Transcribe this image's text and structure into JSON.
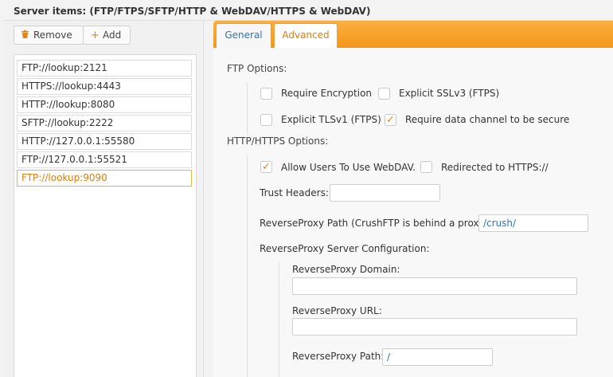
{
  "header": {
    "title": "Server items: (FTP/FTPS/SFTP/HTTP & WebDAV/HTTPS & WebDAV)"
  },
  "toolbar": {
    "remove_label": "Remove",
    "add_label": "Add",
    "remove_icon": "trash-icon",
    "add_icon": "plus-icon"
  },
  "servers": [
    "FTP://lookup:2121",
    "HTTPS://lookup:4443",
    "HTTP://lookup:8080",
    "SFTP://lookup:2222",
    "HTTP://127.0.0.1:55580",
    "FTP://127.0.0.1:55521",
    "FTP://lookup:9090"
  ],
  "selected_server": "FTP://lookup:9090",
  "tabs": {
    "general": "General",
    "advanced": "Advanced",
    "active": "Advanced"
  },
  "ftp": {
    "section": "FTP Options:",
    "require_encryption": {
      "label": "Require Encryption",
      "checked": false
    },
    "explicit_sslv3": {
      "label": "Explicit SSLv3 (FTPS)",
      "checked": false
    },
    "explicit_tlsv1": {
      "label": "Explicit TLSv1 (FTPS)",
      "checked": false
    },
    "require_secure_data": {
      "label": "Require data channel to be secure",
      "checked": true
    }
  },
  "http": {
    "section": "HTTP/HTTPS Options:",
    "allow_webdav": {
      "label": "Allow Users To Use WebDAV.",
      "checked": true
    },
    "redirect_https": {
      "label": "Redirected to HTTPS://",
      "checked": false
    },
    "trust_headers": {
      "label": "Trust Headers:",
      "value": ""
    },
    "reverse_proxy_path": {
      "label": "ReverseProxy Path (CrushFTP is behind a proxy):",
      "value": "/crush/"
    },
    "rp_config_label": "ReverseProxy Server Configuration:",
    "rp_domain": {
      "label": "ReverseProxy Domain:",
      "value": ""
    },
    "rp_url": {
      "label": "ReverseProxy URL:",
      "value": ""
    },
    "rp_path": {
      "label": "ReverseProxy Path:",
      "value": "/"
    }
  },
  "colors": {
    "accent": "#f4961a",
    "link": "#2e73b8",
    "selected": "#e07d10"
  }
}
